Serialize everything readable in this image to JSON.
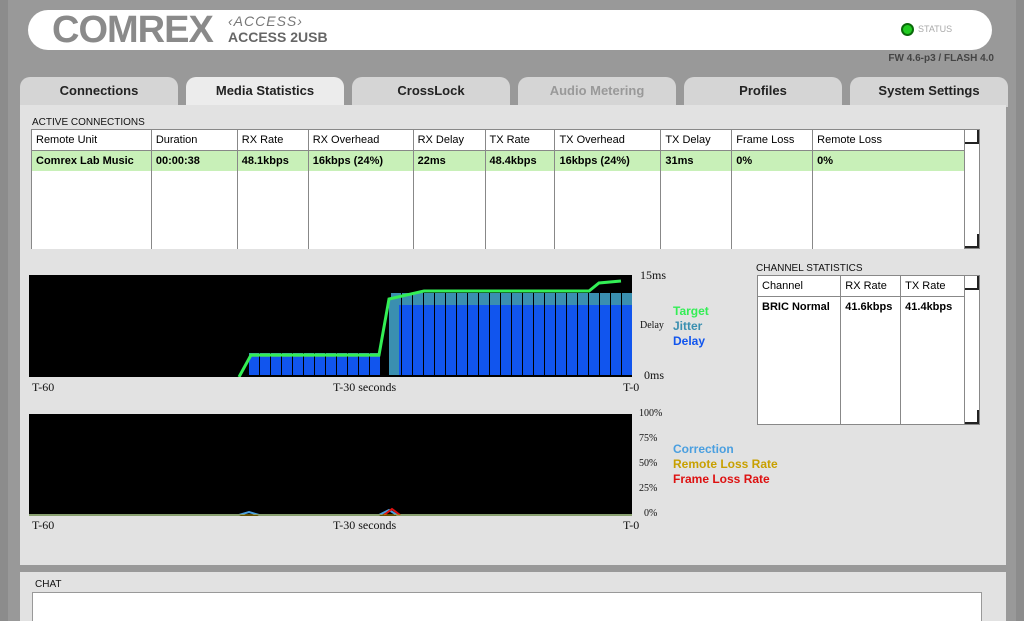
{
  "header": {
    "logo": "COMREX",
    "sub_logo": "ACCESS",
    "product": "ACCESS 2USB",
    "status_label": "STATUS",
    "firmware": "FW 4.6-p3 / FLASH 4.0",
    "status_color": "#22cc22"
  },
  "tabs": [
    {
      "label": "Connections"
    },
    {
      "label": "Media Statistics"
    },
    {
      "label": "CrossLock"
    },
    {
      "label": "Audio Metering"
    },
    {
      "label": "Profiles"
    },
    {
      "label": "System Settings"
    }
  ],
  "active_connections": {
    "title": "ACTIVE CONNECTIONS",
    "columns": [
      "Remote Unit",
      "Duration",
      "RX Rate",
      "RX Overhead",
      "RX Delay",
      "TX Rate",
      "TX Overhead",
      "TX Delay",
      "Frame Loss",
      "Remote Loss"
    ],
    "row": [
      "Comrex Lab Music",
      "00:00:38",
      "48.1kbps",
      "16kbps (24%)",
      "22ms",
      "48.4kbps",
      "16kbps (24%)",
      "31ms",
      "0%",
      "0%"
    ]
  },
  "channel_stats": {
    "title": "CHANNEL STATISTICS",
    "columns": [
      "Channel",
      "RX Rate",
      "TX Rate"
    ],
    "row": [
      "BRIC Normal",
      "41.6kbps",
      "41.4kbps"
    ]
  },
  "delay_chart": {
    "top_label": "15ms",
    "mid_label": "Delay",
    "bottom_label": "0ms",
    "x_left": "T-60",
    "x_mid": "T-30 seconds",
    "x_right": "T-0",
    "legend": {
      "target": "Target",
      "jitter": "Jitter",
      "delay": "Delay"
    },
    "colors": {
      "target": "#33ee55",
      "jitter": "#3a8fb0",
      "delay": "#1155ee"
    }
  },
  "loss_chart": {
    "scale": [
      "100%",
      "75%",
      "50%",
      "25%",
      "0%"
    ],
    "x_left": "T-60",
    "x_mid": "T-30 seconds",
    "x_right": "T-0",
    "legend": {
      "correction": "Correction",
      "remote": "Remote Loss Rate",
      "frame": "Frame Loss Rate"
    },
    "colors": {
      "correction": "#4a9fe0",
      "remote": "#c8a000",
      "frame": "#dd1111"
    }
  },
  "chat": {
    "title": "CHAT"
  }
}
